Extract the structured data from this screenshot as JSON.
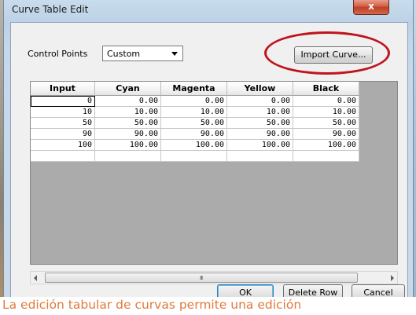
{
  "window": {
    "title": "Curve Table Edit",
    "close_glyph": "x"
  },
  "controls": {
    "control_points_label": "Control Points",
    "control_points_value": "Custom",
    "import_button": "Import Curve..."
  },
  "table": {
    "columns": [
      "Input",
      "Cyan",
      "Magenta",
      "Yellow",
      "Black"
    ],
    "rows": [
      [
        "0",
        "0.00",
        "0.00",
        "0.00",
        "0.00"
      ],
      [
        "10",
        "10.00",
        "10.00",
        "10.00",
        "10.00"
      ],
      [
        "50",
        "50.00",
        "50.00",
        "50.00",
        "50.00"
      ],
      [
        "90",
        "90.00",
        "90.00",
        "90.00",
        "90.00"
      ],
      [
        "100",
        "100.00",
        "100.00",
        "100.00",
        "100.00"
      ]
    ]
  },
  "scrollbar": {
    "grip": "III"
  },
  "buttons": {
    "ok": "OK",
    "delete_row": "Delete Row",
    "cancel": "Cancel"
  },
  "caption": "La edición tabular de curvas permite una edición",
  "colors": {
    "highlight_ellipse": "#c0141d",
    "caption_text": "#e07a3e",
    "close_button": "#c8432b"
  }
}
